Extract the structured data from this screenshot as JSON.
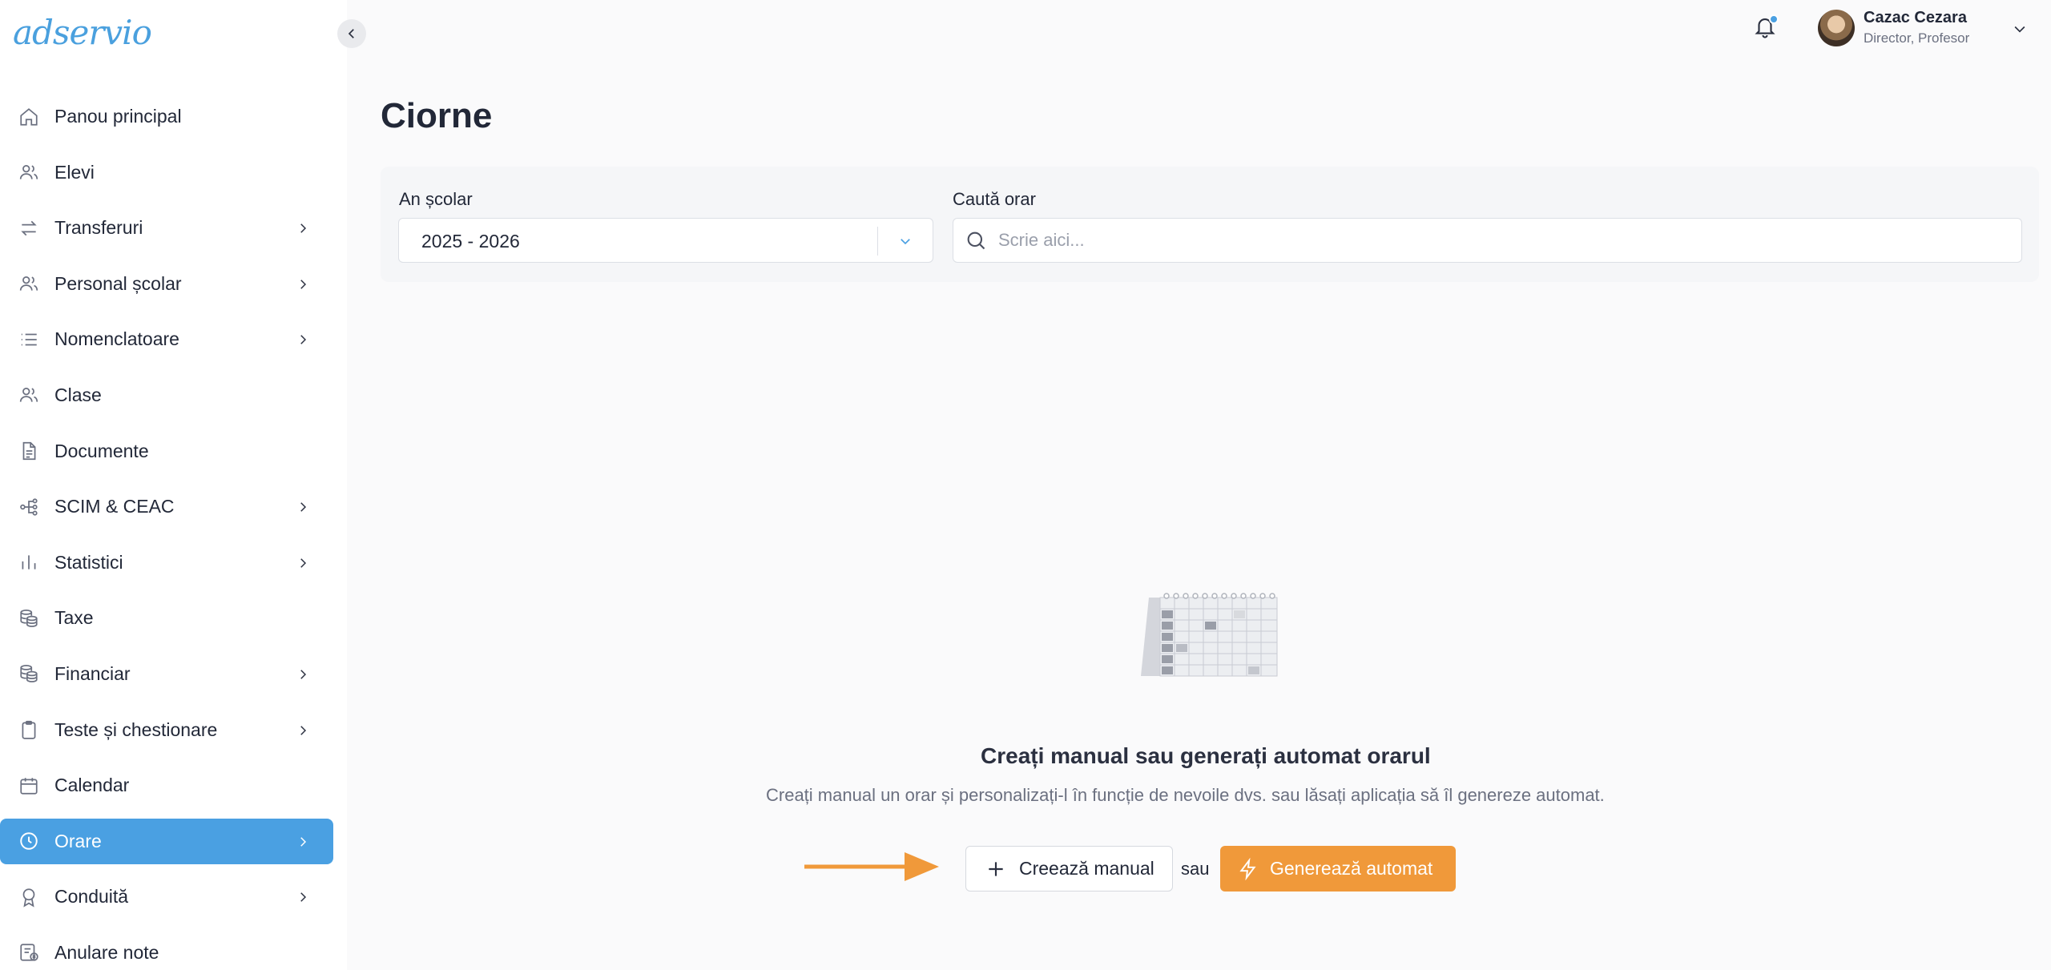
{
  "app": {
    "logo_text": "adservio",
    "accent_color": "#4aa0e2",
    "warning_color": "#f0993a"
  },
  "user": {
    "name": "Cazac Cezara",
    "role": "Director, Profesor",
    "has_notifications": true
  },
  "sidebar": {
    "items": [
      {
        "label": "Panou principal",
        "icon": "home-icon",
        "has_submenu": false,
        "active": false
      },
      {
        "label": "Elevi",
        "icon": "users-icon",
        "has_submenu": false,
        "active": false
      },
      {
        "label": "Transferuri",
        "icon": "transfer-icon",
        "has_submenu": true,
        "active": false
      },
      {
        "label": "Personal școlar",
        "icon": "staff-icon",
        "has_submenu": true,
        "active": false
      },
      {
        "label": "Nomenclatoare",
        "icon": "list-icon",
        "has_submenu": true,
        "active": false
      },
      {
        "label": "Clase",
        "icon": "class-icon",
        "has_submenu": false,
        "active": false
      },
      {
        "label": "Documente",
        "icon": "document-icon",
        "has_submenu": false,
        "active": false
      },
      {
        "label": "SCIM & CEAC",
        "icon": "network-icon",
        "has_submenu": true,
        "active": false
      },
      {
        "label": "Statistici",
        "icon": "bar-chart-icon",
        "has_submenu": true,
        "active": false
      },
      {
        "label": "Taxe",
        "icon": "coins-icon",
        "has_submenu": false,
        "active": false
      },
      {
        "label": "Financiar",
        "icon": "coins-icon",
        "has_submenu": true,
        "active": false
      },
      {
        "label": "Teste și chestionare",
        "icon": "clipboard-icon",
        "has_submenu": true,
        "active": false
      },
      {
        "label": "Calendar",
        "icon": "calendar-icon",
        "has_submenu": false,
        "active": false
      },
      {
        "label": "Orare",
        "icon": "clock-icon",
        "has_submenu": true,
        "active": true
      },
      {
        "label": "Conduită",
        "icon": "award-icon",
        "has_submenu": true,
        "active": false
      },
      {
        "label": "Anulare note",
        "icon": "cancel-grades-icon",
        "has_submenu": false,
        "active": false
      }
    ]
  },
  "page": {
    "title": "Ciorne"
  },
  "filters": {
    "year_label": "An școlar",
    "year_value": "2025 - 2026",
    "search_label": "Caută orar",
    "search_placeholder": "Scrie aici..."
  },
  "empty_state": {
    "title": "Creați manual sau generați automat orarul",
    "subtitle": "Creați manual un orar și personalizați-l în funcție de nevoile dvs. sau lăsați aplicația să îl genereze automat.",
    "manual_button": "Creează manual",
    "or_text": "sau",
    "auto_button": "Generează automat"
  }
}
